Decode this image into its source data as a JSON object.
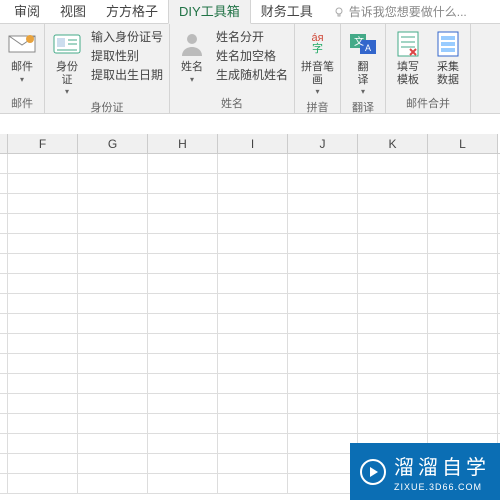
{
  "tabs": {
    "review": "审阅",
    "view": "视图",
    "fangfang": "方方格子",
    "diy": "DIY工具箱",
    "finance": "财务工具",
    "tellme": "告诉我您想要做什么..."
  },
  "ribbon": {
    "mail": {
      "label": "邮件",
      "group": "邮件"
    },
    "idcard": {
      "label": "身份\n证",
      "cmds": [
        "输入身份证号",
        "提取性别",
        "提取出生日期"
      ],
      "group": "身份证"
    },
    "name": {
      "label": "姓名",
      "cmds": [
        "姓名分开",
        "姓名加空格",
        "生成随机姓名"
      ],
      "group": "姓名"
    },
    "pinyin": {
      "label": "拼音笔\n画",
      "group": "拼音"
    },
    "translate": {
      "label": "翻\n译",
      "group": "翻译"
    },
    "fill": {
      "label": "填写\n模板"
    },
    "collect": {
      "label": "采集\n数据"
    },
    "merge_group": "邮件合并"
  },
  "columns": [
    "F",
    "G",
    "H",
    "I",
    "J",
    "K",
    "L"
  ],
  "watermark": {
    "title": "溜溜自学",
    "sub": "ZIXUE.3D66.COM"
  }
}
